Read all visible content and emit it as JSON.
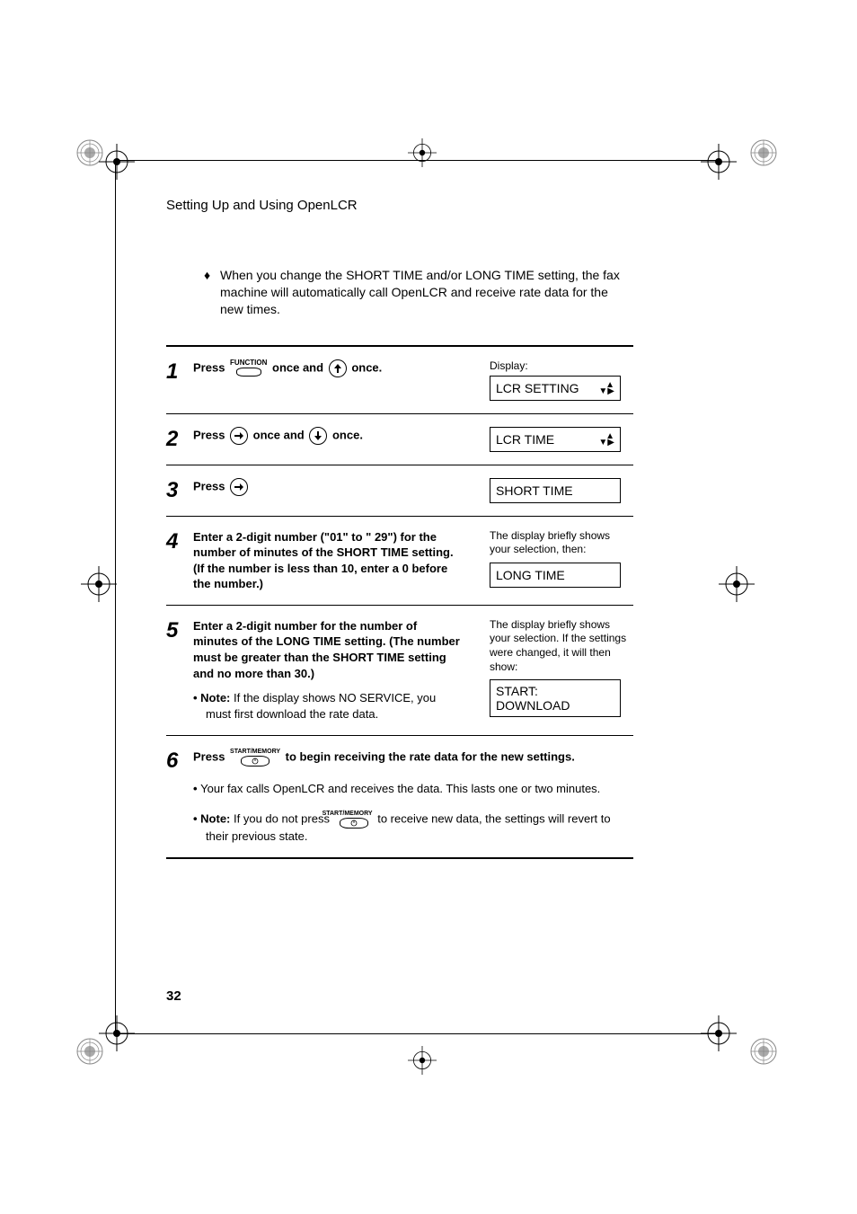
{
  "running_head": "Setting Up and Using OpenLCR",
  "intro": "When you change the SHORT TIME and/or LONG TIME setting, the fax machine will automatically call OpenLCR and receive rate data for the new times.",
  "steps": {
    "s1": {
      "num": "1",
      "press": "Press ",
      "once_and": " once and ",
      "once_end": " once.",
      "display_label": "Display:",
      "display_text": "LCR SETTING"
    },
    "s2": {
      "num": "2",
      "press": "Press ",
      "once_and": " once and ",
      "once_end": " once.",
      "display_text": "LCR TIME"
    },
    "s3": {
      "num": "3",
      "press": "Press ",
      "display_text": "SHORT TIME"
    },
    "s4": {
      "num": "4",
      "body": "Enter a 2-digit number (\"01\" to \" 29\") for the number of minutes of the SHORT TIME setting. (If the number is less than 10, enter a 0 before the number.)",
      "side_note": "The display briefly shows your selection, then:",
      "display_text": "LONG TIME"
    },
    "s5": {
      "num": "5",
      "body": "Enter a 2-digit number for the number of minutes of the LONG TIME setting. (The number must be greater than the SHORT TIME setting and no more than 30.)",
      "note_label": "Note:",
      "note_body": " If the display shows NO SERVICE, you must first download the rate data.",
      "side_note": "The display briefly shows your selection. If the settings were changed, it will then show:",
      "display_text": "START: DOWNLOAD"
    },
    "s6": {
      "num": "6",
      "press": "Press ",
      "after": " to begin receiving the rate data for the new settings.",
      "bullet1": "Your fax calls OpenLCR and receives the data. This lasts one or two minutes.",
      "note_label": "Note:",
      "note_pre": " If you do not press ",
      "note_post": " to receive new data, the settings will revert to their previous state."
    }
  },
  "key_labels": {
    "function": "FUNCTION",
    "start_memory": "START/MEMORY"
  },
  "page_number": "32"
}
